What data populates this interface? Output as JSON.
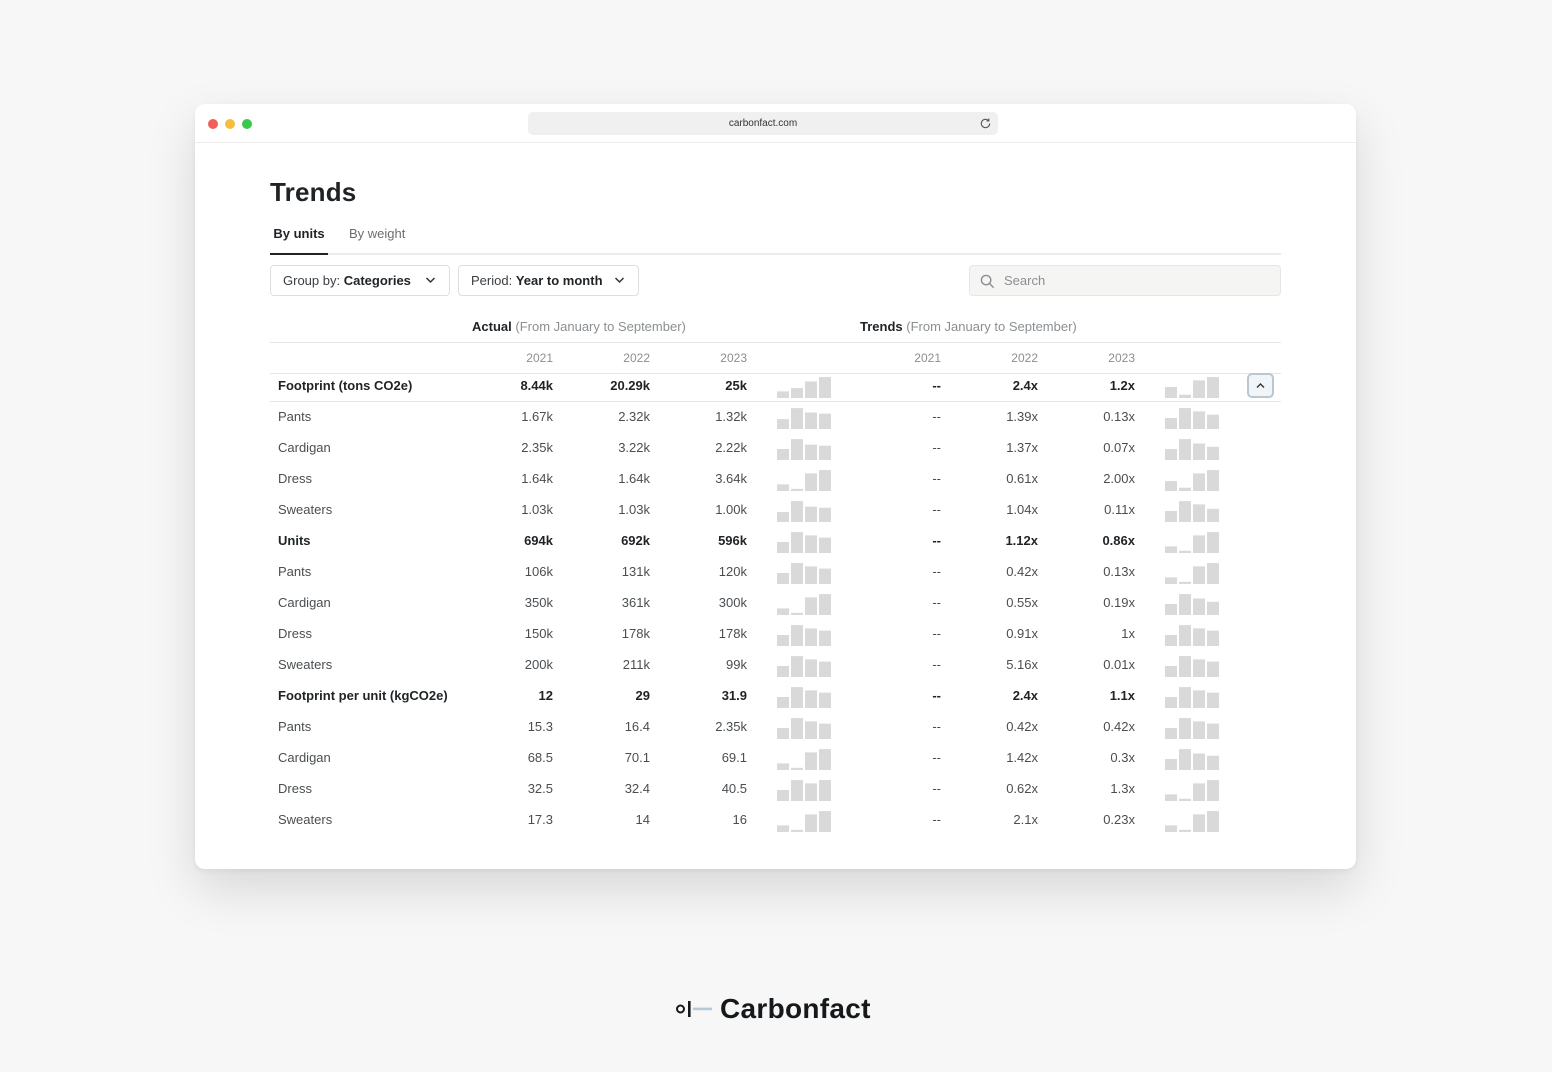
{
  "browser": {
    "url": "carbonfact.com"
  },
  "page": {
    "title": "Trends"
  },
  "tabs": [
    {
      "label": "By units",
      "active": true
    },
    {
      "label": "By weight",
      "active": false
    }
  ],
  "filters": {
    "group_prefix": "Group by:",
    "group_value": "Categories",
    "period_prefix": "Period:",
    "period_value": "Year to month"
  },
  "search": {
    "placeholder": "Search",
    "value": ""
  },
  "sections": {
    "actual_title": "Actual",
    "actual_range": "(From January to September)",
    "trends_title": "Trends",
    "trends_range": "(From January to September)"
  },
  "years": [
    "2021",
    "2022",
    "2023"
  ],
  "rows": [
    {
      "label": "Footprint (tons CO2e)",
      "bold": true,
      "actual": [
        "8.44k",
        "20.29k",
        "25k"
      ],
      "trends": [
        "--",
        "2.4x",
        "1.2x"
      ],
      "spark_actual": [
        0.3,
        0.45,
        0.75,
        0.95
      ],
      "spark_trend": [
        0.5,
        0.15,
        0.8,
        0.95
      ]
    },
    {
      "label": "Pants",
      "bold": false,
      "actual": [
        "1.67k",
        "2.32k",
        "1.32k"
      ],
      "trends": [
        "--",
        "1.39x",
        "0.13x"
      ],
      "spark_actual": [
        0.45,
        0.95,
        0.75,
        0.7
      ],
      "spark_trend": [
        0.5,
        0.95,
        0.8,
        0.65
      ]
    },
    {
      "label": "Cardigan",
      "bold": false,
      "actual": [
        "2.35k",
        "3.22k",
        "2.22k"
      ],
      "trends": [
        "--",
        "1.37x",
        "0.07x"
      ],
      "spark_actual": [
        0.5,
        0.95,
        0.7,
        0.65
      ],
      "spark_trend": [
        0.5,
        0.95,
        0.75,
        0.6
      ]
    },
    {
      "label": "Dress",
      "bold": false,
      "actual": [
        "1.64k",
        "1.64k",
        "3.64k"
      ],
      "trends": [
        "--",
        "0.61x",
        "2.00x"
      ],
      "spark_actual": [
        0.3,
        0.1,
        0.8,
        0.95
      ],
      "spark_trend": [
        0.45,
        0.15,
        0.8,
        0.95
      ]
    },
    {
      "label": "Sweaters",
      "bold": false,
      "actual": [
        "1.03k",
        "1.03k",
        "1.00k"
      ],
      "trends": [
        "--",
        "1.04x",
        "0.11x"
      ],
      "spark_actual": [
        0.45,
        0.95,
        0.7,
        0.65
      ],
      "spark_trend": [
        0.5,
        0.95,
        0.8,
        0.6
      ]
    },
    {
      "label": "Units",
      "bold": true,
      "actual": [
        "694k",
        "692k",
        "596k"
      ],
      "trends": [
        "--",
        "1.12x",
        "0.86x"
      ],
      "spark_actual": [
        0.5,
        0.95,
        0.8,
        0.7
      ],
      "spark_trend": [
        0.3,
        0.1,
        0.8,
        0.95
      ]
    },
    {
      "label": "Pants",
      "bold": false,
      "actual": [
        "106k",
        "131k",
        "120k"
      ],
      "trends": [
        "--",
        "0.42x",
        "0.13x"
      ],
      "spark_actual": [
        0.5,
        0.95,
        0.8,
        0.7
      ],
      "spark_trend": [
        0.3,
        0.1,
        0.8,
        0.95
      ]
    },
    {
      "label": "Cardigan",
      "bold": false,
      "actual": [
        "350k",
        "361k",
        "300k"
      ],
      "trends": [
        "--",
        "0.55x",
        "0.19x"
      ],
      "spark_actual": [
        0.3,
        0.1,
        0.8,
        0.95
      ],
      "spark_trend": [
        0.5,
        0.95,
        0.75,
        0.6
      ]
    },
    {
      "label": "Dress",
      "bold": false,
      "actual": [
        "150k",
        "178k",
        "178k"
      ],
      "trends": [
        "--",
        "0.91x",
        "1x"
      ],
      "spark_actual": [
        0.5,
        0.95,
        0.8,
        0.7
      ],
      "spark_trend": [
        0.5,
        0.95,
        0.8,
        0.7
      ]
    },
    {
      "label": "Sweaters",
      "bold": false,
      "actual": [
        "200k",
        "211k",
        "99k"
      ],
      "trends": [
        "--",
        "5.16x",
        "0.01x"
      ],
      "spark_actual": [
        0.5,
        0.95,
        0.8,
        0.7
      ],
      "spark_trend": [
        0.5,
        0.95,
        0.8,
        0.7
      ]
    },
    {
      "label": "Footprint per unit (kgCO2e)",
      "bold": true,
      "actual": [
        "12",
        "29",
        "31.9"
      ],
      "trends": [
        "--",
        "2.4x",
        "1.1x"
      ],
      "spark_actual": [
        0.5,
        0.95,
        0.8,
        0.7
      ],
      "spark_trend": [
        0.5,
        0.95,
        0.8,
        0.7
      ]
    },
    {
      "label": "Pants",
      "bold": false,
      "actual": [
        "15.3",
        "16.4",
        "2.35k"
      ],
      "trends": [
        "--",
        "0.42x",
        "0.42x"
      ],
      "spark_actual": [
        0.5,
        0.95,
        0.8,
        0.7
      ],
      "spark_trend": [
        0.5,
        0.95,
        0.8,
        0.7
      ]
    },
    {
      "label": "Cardigan",
      "bold": false,
      "actual": [
        "68.5",
        "70.1",
        "69.1"
      ],
      "trends": [
        "--",
        "1.42x",
        "0.3x"
      ],
      "spark_actual": [
        0.3,
        0.1,
        0.8,
        0.95
      ],
      "spark_trend": [
        0.5,
        0.95,
        0.75,
        0.65
      ]
    },
    {
      "label": "Dress",
      "bold": false,
      "actual": [
        "32.5",
        "32.4",
        "40.5"
      ],
      "trends": [
        "--",
        "0.62x",
        "1.3x"
      ],
      "spark_actual": [
        0.5,
        0.95,
        0.8,
        0.95
      ],
      "spark_trend": [
        0.3,
        0.1,
        0.8,
        0.95
      ]
    },
    {
      "label": "Sweaters",
      "bold": false,
      "actual": [
        "17.3",
        "14",
        "16"
      ],
      "trends": [
        "--",
        "2.1x",
        "0.23x"
      ],
      "spark_actual": [
        0.3,
        0.1,
        0.8,
        0.95
      ],
      "spark_trend": [
        0.3,
        0.1,
        0.8,
        0.95
      ]
    }
  ],
  "brand": {
    "name": "Carbonfact"
  },
  "colors": {
    "accent_border": "#b8c7d2",
    "spark_bar": "#d9d9d9",
    "traffic_red": "#f25f58",
    "traffic_yellow": "#f8bd3b",
    "traffic_green": "#3ac84a"
  },
  "icons": {
    "search": "search-icon",
    "chevron": "chevron-down-icon",
    "collapse": "chevron-up-icon",
    "reload": "reload-icon"
  }
}
